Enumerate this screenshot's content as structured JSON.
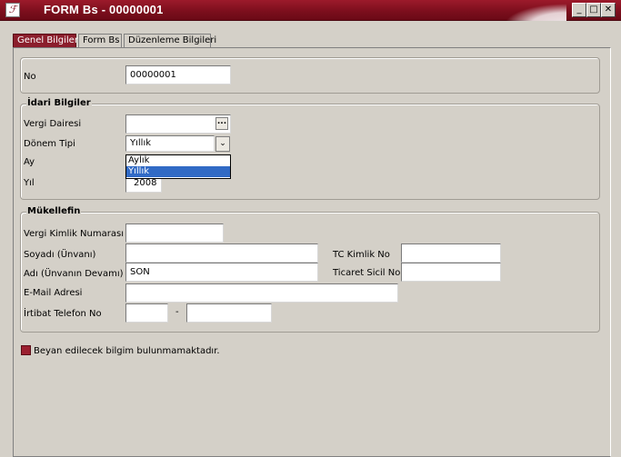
{
  "window": {
    "title": "FORM Bs - 00000001",
    "app_icon_glyph": "ℱ",
    "min_glyph": "_",
    "max_glyph": "□",
    "close_glyph": "✕",
    "accent_color": "#7d0f1d"
  },
  "tabs": [
    {
      "label": "Genel Bilgiler",
      "active": true
    },
    {
      "label": "Form Bs",
      "active": false
    },
    {
      "label": "Düzenleme Bilgileri",
      "active": false
    }
  ],
  "general": {
    "no_label": "No",
    "no_value": "00000001"
  },
  "idari": {
    "title": "İdari Bilgiler",
    "vergi_dairesi_label": "Vergi Dairesi",
    "vergi_dairesi_value": "",
    "lookup_glyph": "...",
    "donem_tipi_label": "Dönem Tipi",
    "donem_tipi_value": "Yıllık",
    "donem_options": [
      "Aylık",
      "Yıllık"
    ],
    "dropdown_glyph": "⌄",
    "ay_label": "Ay",
    "yil_label": "Yıl",
    "yil_value": "2008"
  },
  "mukellefin": {
    "title": "Mükellefin",
    "vkn_label": "Vergi Kimlik Numarası",
    "vkn_value": "",
    "soyadi_label": "Soyadı (Ünvanı)",
    "soyadi_value": "",
    "tc_label": "TC Kimlik No",
    "tc_value": "",
    "adi_label": "Adı (Ünvanın Devamı)",
    "adi_value": "SON",
    "ticaret_label": "Ticaret Sicil No",
    "ticaret_value": "",
    "email_label": "E-Mail Adresi",
    "email_value": "",
    "telefon_label": "İrtibat Telefon No",
    "telefon_area": "",
    "telefon_sep": "-",
    "telefon_number": ""
  },
  "beyan": {
    "label": "Beyan edilecek bilgim bulunmamaktadır.",
    "checked": false
  }
}
